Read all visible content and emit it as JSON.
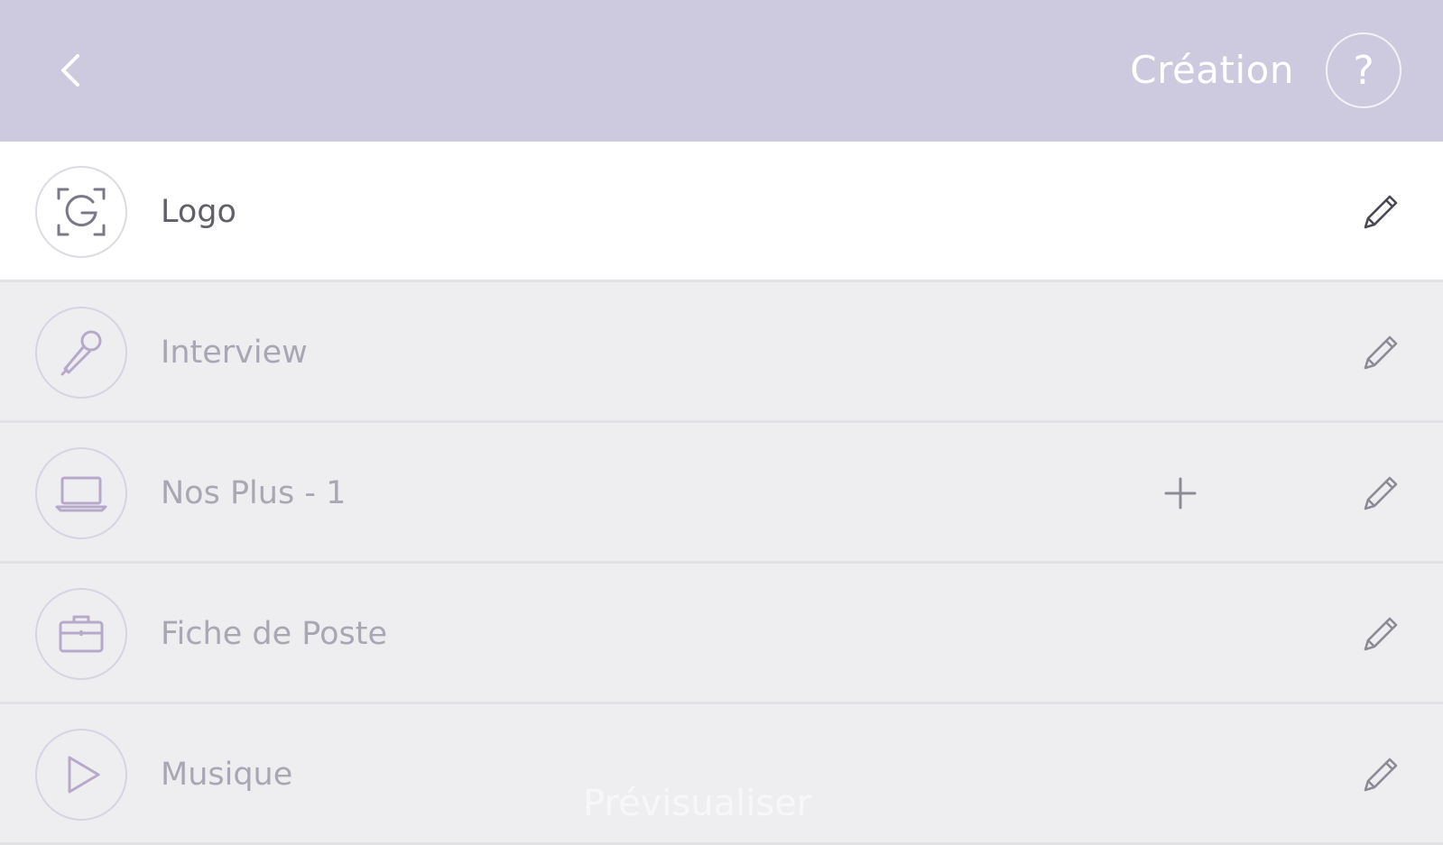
{
  "header": {
    "title": "Création",
    "help_label": "?",
    "background": "#cdcadf"
  },
  "list": {
    "items": [
      {
        "label": "Logo",
        "icon": "logo-icon",
        "active": true
      },
      {
        "label": "Interview",
        "icon": "microphone-icon",
        "active": false
      },
      {
        "label": "Nos Plus - 1",
        "icon": "laptop-icon",
        "active": false,
        "has_add": true
      },
      {
        "label": "Fiche de Poste",
        "icon": "briefcase-icon",
        "active": false
      },
      {
        "label": "Musique",
        "icon": "play-icon",
        "active": false
      }
    ]
  },
  "footer": {
    "preview_label": "Prévisualiser"
  },
  "colors": {
    "accent": "#8a7fa8",
    "row_bg": "#eeeef1",
    "active_row_bg": "#ffffff"
  }
}
